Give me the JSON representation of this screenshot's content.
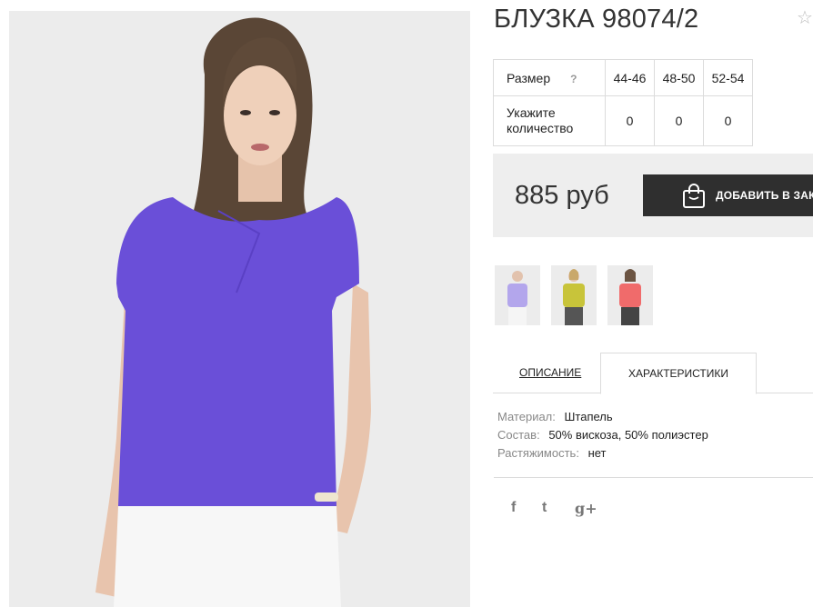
{
  "product": {
    "title": "БЛУЗКА 98074/2",
    "favorite_icon": "star-icon",
    "price": "885 руб",
    "add_to_cart_label": "ДОБАВИТЬ В ЗАКАЗ",
    "bag_icon": "shopping-bag-icon"
  },
  "size_table": {
    "size_label": "Размер",
    "help_mark": "?",
    "sizes": [
      "44-46",
      "48-50",
      "52-54"
    ],
    "quantity_label_line1": "Укажите",
    "quantity_label_line2": "количество",
    "quantities": [
      "0",
      "0",
      "0"
    ]
  },
  "colors": {
    "main_blouse": "#6a4fd8",
    "thumb_1": "#b3a6ec",
    "thumb_2": "#c8c43a",
    "thumb_3": "#f06b6b",
    "button_bg": "#2f2f2f",
    "buy_box_bg": "#eeeeee"
  },
  "tabs": {
    "description": "ОПИСАНИЕ",
    "characteristics": "ХАРАКТЕРИСТИКИ",
    "active": "characteristics"
  },
  "specs": [
    {
      "key": "Материал:",
      "value": "Штапель"
    },
    {
      "key": "Состав:",
      "value": "50% вискоза, 50% полиэстер"
    },
    {
      "key": "Растяжимость:",
      "value": "нет"
    }
  ],
  "social": {
    "facebook": "f",
    "twitter": "t",
    "google_plus": "g+"
  }
}
